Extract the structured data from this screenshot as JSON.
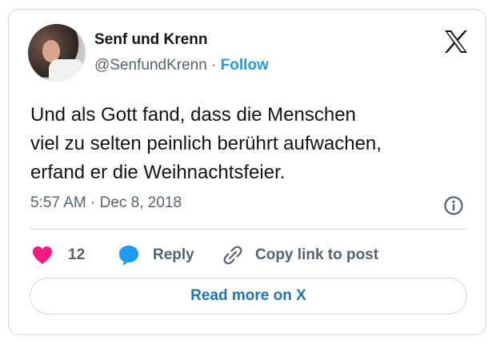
{
  "author": {
    "name": "Senf und Krenn",
    "handle": "@SenfundKrenn",
    "separator": "·",
    "follow_label": "Follow"
  },
  "tweet": {
    "lines": [
      "Und als Gott fand, dass die Menschen",
      "viel zu selten peinlich berührt aufwachen,",
      "erfand er die Weihnachtsfeier."
    ],
    "time": "5:57 AM",
    "separator": "·",
    "date": "Dec 8, 2018"
  },
  "actions": {
    "like_count": "12",
    "reply_label": "Reply",
    "copy_label": "Copy link to post"
  },
  "read_more_label": "Read more on X",
  "icons": {
    "avatar": "profile-photo",
    "logo": "x-logo-icon",
    "info": "info-circle-icon",
    "like": "heart-icon",
    "reply": "speech-bubble-icon",
    "copy": "link-icon"
  },
  "colors": {
    "accent": "#1d9bf0",
    "heart": "#f91880",
    "text": "#0f1419",
    "muted": "#536471",
    "border": "#cfd9de"
  }
}
